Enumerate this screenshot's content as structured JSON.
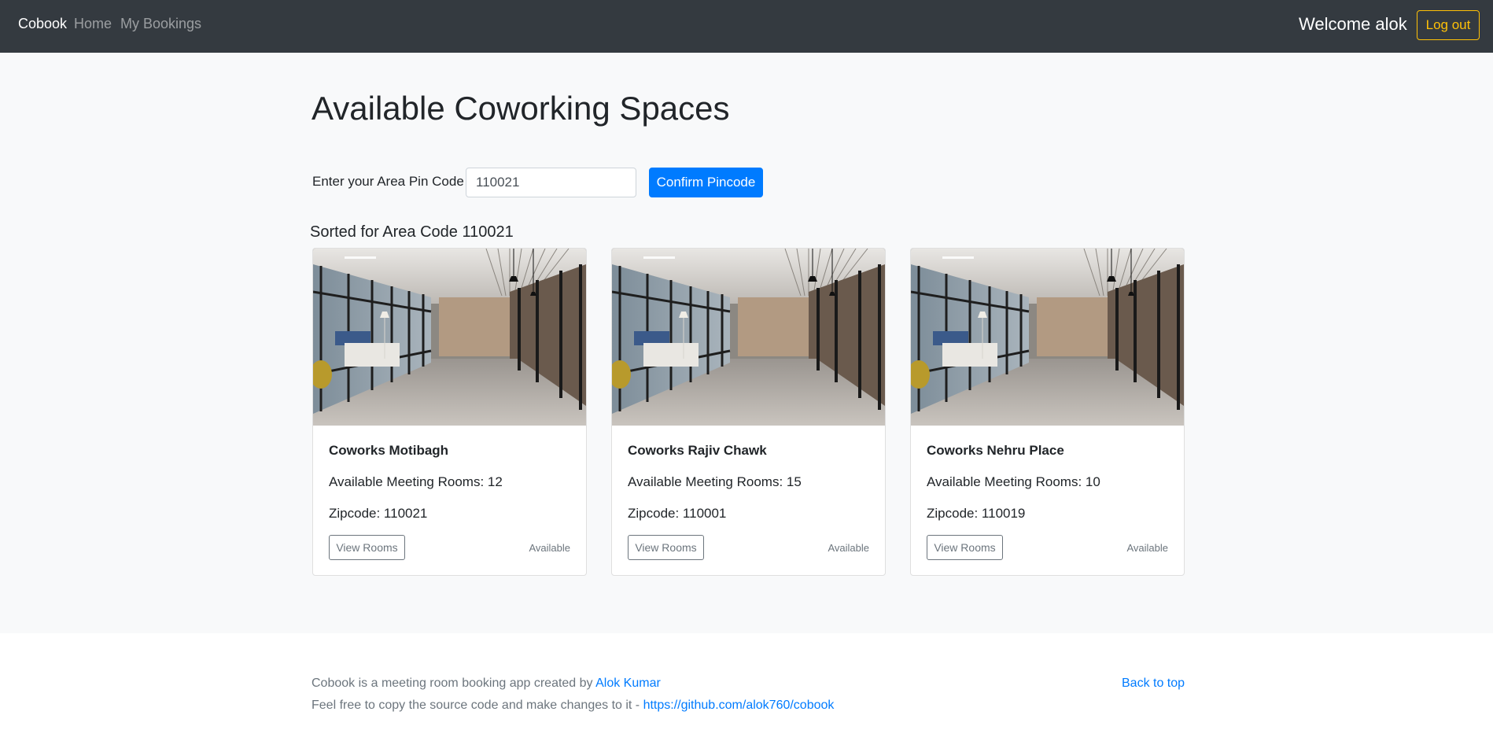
{
  "navbar": {
    "brand": "Cobook",
    "links": [
      "Home",
      "My Bookings"
    ],
    "welcome": "Welcome alok",
    "logout_label": "Log out"
  },
  "main": {
    "title": "Available Coworking Spaces",
    "pin_label": "Enter your Area Pin Code",
    "pin_value": "110021",
    "confirm_label": "Confirm Pincode",
    "sorted_text": "Sorted for Area Code 110021"
  },
  "cards": [
    {
      "name": "Coworks Motibagh",
      "rooms": "Available Meeting Rooms: 12",
      "zipcode": "Zipcode: 110021",
      "button": "View Rooms",
      "status": "Available"
    },
    {
      "name": "Coworks Rajiv Chawk",
      "rooms": "Available Meeting Rooms: 15",
      "zipcode": "Zipcode: 110001",
      "button": "View Rooms",
      "status": "Available"
    },
    {
      "name": "Coworks Nehru Place",
      "rooms": "Available Meeting Rooms: 10",
      "zipcode": "Zipcode: 110019",
      "button": "View Rooms",
      "status": "Available"
    }
  ],
  "footer": {
    "line1_text": "Cobook is a meeting room booking app created by ",
    "author_link": "Alok Kumar",
    "line2_text": "Feel free to copy the source code and make changes to it - ",
    "repo_link": "https://github.com/alok760/cobook",
    "back_to_top": "Back to top"
  },
  "colors": {
    "navbar_bg": "#343a40",
    "primary": "#007bff",
    "warning": "#ffc107",
    "muted": "#6c757d",
    "page_bg": "#f8f9fa"
  },
  "icons": {
    "card_image": "office-corridor-photo"
  }
}
